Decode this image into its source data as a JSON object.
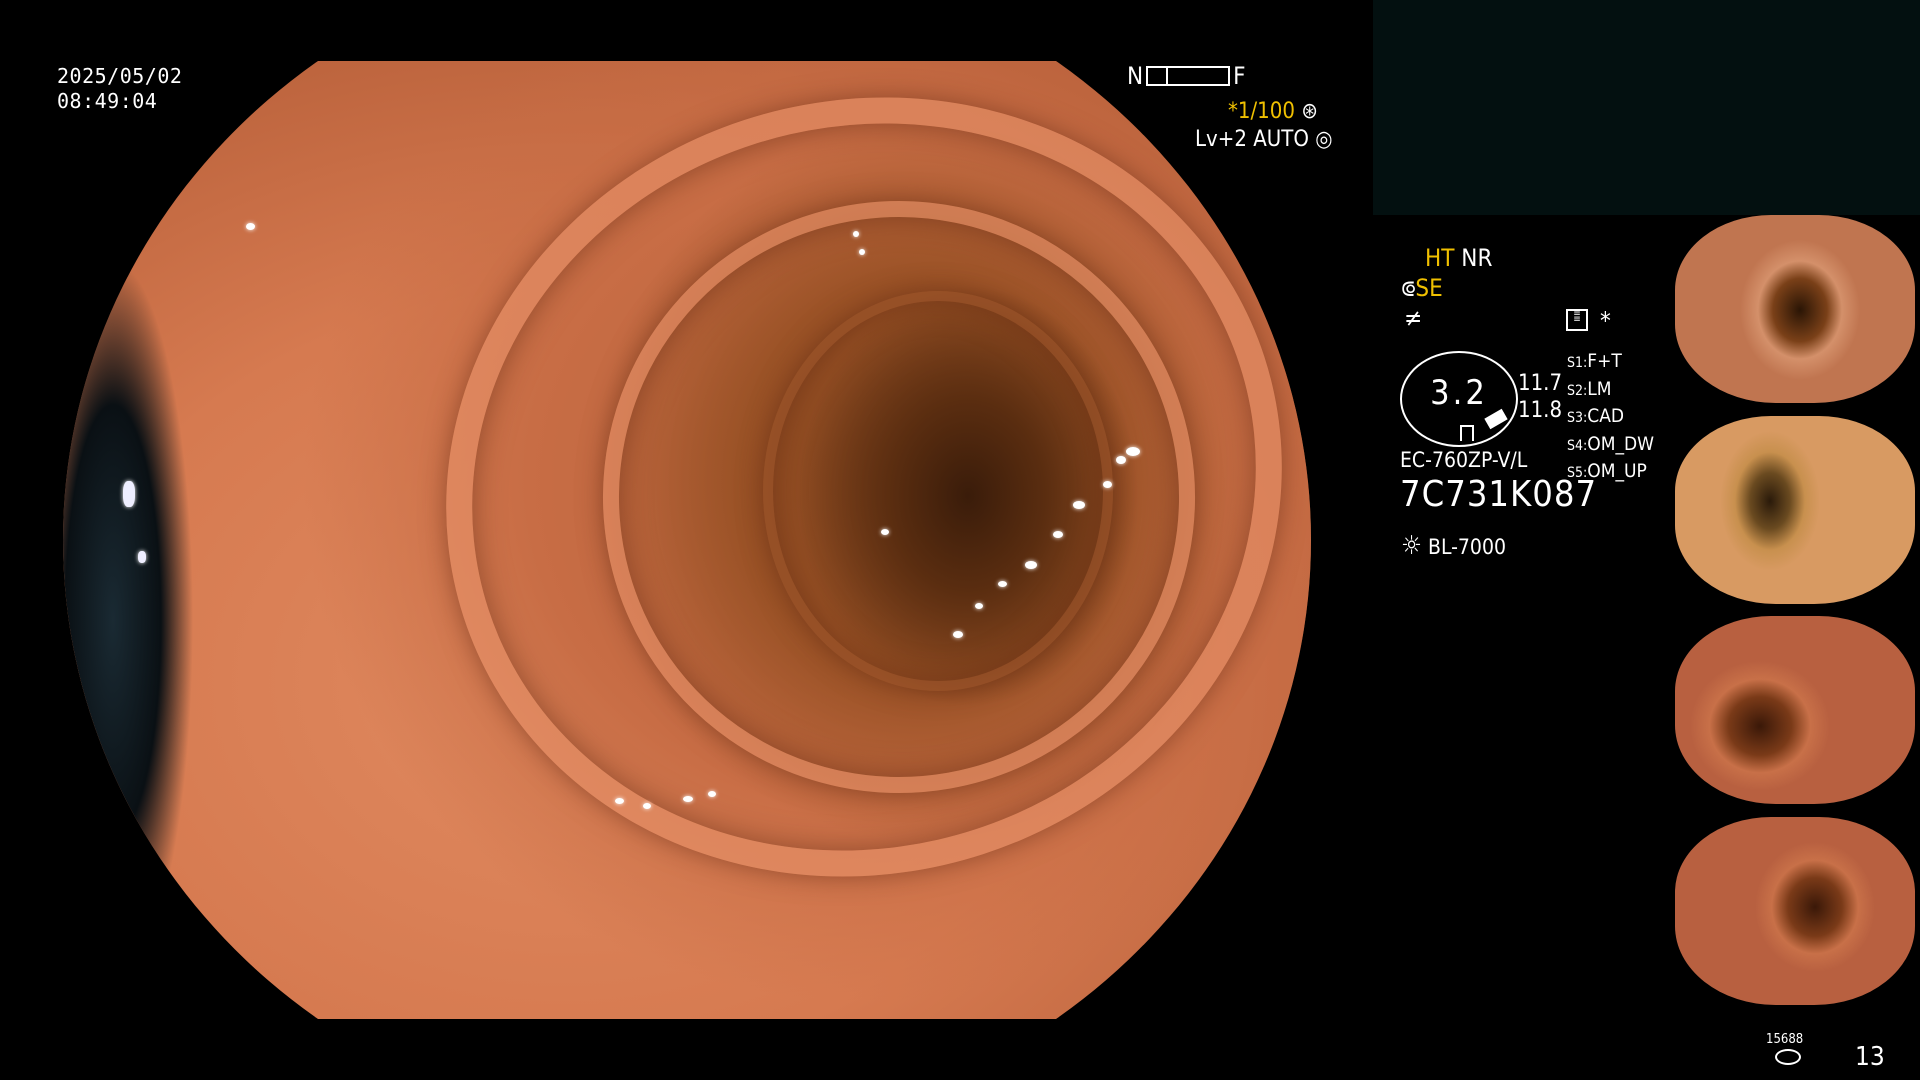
{
  "timestamp": {
    "date": "2025/05/02",
    "time": "08:49:04"
  },
  "scope_status": {
    "near_label": "N",
    "far_label": "F",
    "shutter": "*1/100",
    "shutter_icon": "aperture-icon",
    "iris_level": "Lv+2",
    "iris_mode": "AUTO",
    "iris_icon": "iris-icon"
  },
  "settings": {
    "ht": "HT",
    "nr": "NR",
    "se": "SE",
    "se_icon": "brush-icon",
    "freeze_icon": "freeze-icon",
    "memo_icon": "memo-icon",
    "asterisk": "*"
  },
  "zoom": {
    "value": "3.2",
    "upper": "11.7",
    "lower": "11.8"
  },
  "switch_assignments": [
    {
      "key": "S1",
      "action": "F+T"
    },
    {
      "key": "S2",
      "action": "LM"
    },
    {
      "key": "S3",
      "action": "CAD"
    },
    {
      "key": "S4",
      "action": "OM_DW"
    },
    {
      "key": "S5",
      "action": "OM_UP"
    }
  ],
  "device": {
    "model": "EC-760ZP-V/L",
    "serial": "7C731K087",
    "light_source": "BL-7000",
    "light_icon": "sun-icon"
  },
  "footer": {
    "storage_count": "15688",
    "storage_icon": "disk-stack-icon",
    "image_count": "13"
  },
  "thumbnails": [
    {
      "name": "thumbnail-1"
    },
    {
      "name": "thumbnail-2"
    },
    {
      "name": "thumbnail-3"
    },
    {
      "name": "thumbnail-4"
    }
  ],
  "colors": {
    "accent_yellow": "#f0c000",
    "background": "#000000",
    "panel": "#031010"
  }
}
